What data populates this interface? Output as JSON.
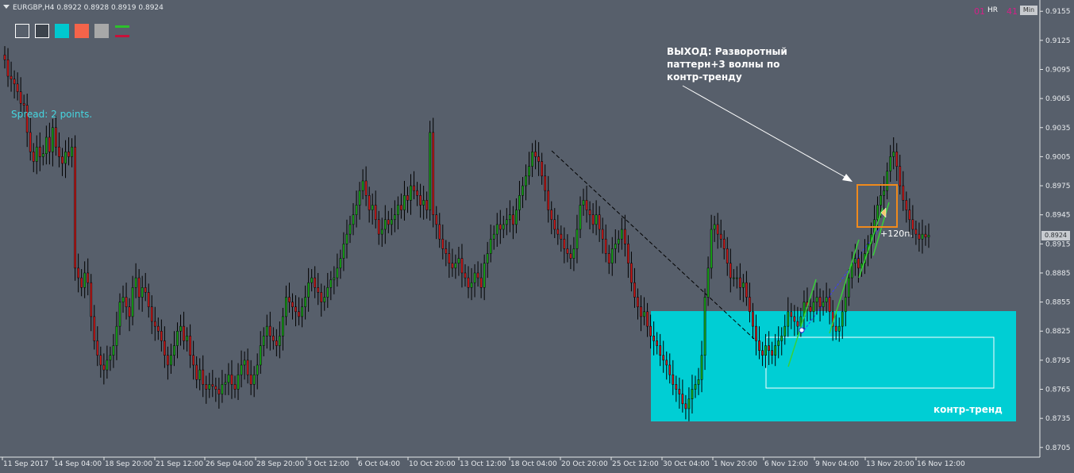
{
  "chart_header": "EURGBP,H4  0.8922 0.8928 0.8919 0.8924",
  "spread": "Spread: 2 points.",
  "annotation": {
    "line1": "ВЫХОД: Разворотный",
    "line2": "паттерн+3 волны по",
    "line3": "контр-тренду"
  },
  "profit_label": "+120п.",
  "zone_label": "контр-тренд",
  "top_right": {
    "hr": "HR",
    "left_digits": "01",
    "right_digits": "41",
    "min_button": "Min"
  },
  "current_price": "0.8924",
  "toolbar_swatches": [
    {
      "name": "swatch-white-frame",
      "color": "#575f6b",
      "border": "#ffffff"
    },
    {
      "name": "swatch-dark-frame",
      "color": "#3c434c",
      "border": "#ffffff"
    },
    {
      "name": "swatch-cyan",
      "color": "#00c8cf",
      "border": "#00c8cf"
    },
    {
      "name": "swatch-coral",
      "color": "#f4644a",
      "border": "#f4644a"
    },
    {
      "name": "swatch-gray",
      "color": "#a8a8a8",
      "border": "#a8a8a8"
    }
  ],
  "colors": {
    "background": "#575f6b",
    "bull_candle": "#16a816",
    "bear_candle": "#d01818",
    "wick": "#000000",
    "zone": "#00ced4",
    "target_box": "#f08a1c",
    "wave_lines": "#38d038",
    "trend_line": "#000000",
    "blue_line": "#3b3cff"
  },
  "chart_data": {
    "type": "candlestick",
    "symbol": "EURGBP",
    "timeframe": "H4",
    "ohlc_last": {
      "open": 0.8922,
      "high": 0.8928,
      "low": 0.8919,
      "close": 0.8924
    },
    "ylim": [
      0.8695,
      0.9165
    ],
    "y_ticks": [
      "0.9155",
      "0.9125",
      "0.9095",
      "0.9065",
      "0.9035",
      "0.9005",
      "0.8975",
      "0.8945",
      "0.8915",
      "0.8885",
      "0.8855",
      "0.8825",
      "0.8795",
      "0.8765",
      "0.8735",
      "0.8705"
    ],
    "x_ticks": [
      "11 Sep 2017",
      "14 Sep 04:00",
      "18 Sep 20:00",
      "21 Sep 12:00",
      "26 Sep 04:00",
      "28 Sep 20:00",
      "3 Oct 12:00",
      "6 Oct 04:00",
      "10 Oct 20:00",
      "13 Oct 12:00",
      "18 Oct 04:00",
      "20 Oct 20:00",
      "25 Oct 12:00",
      "30 Oct 04:00",
      "1 Nov 20:00",
      "6 Nov 12:00",
      "9 Nov 04:00",
      "13 Nov 20:00",
      "16 Nov 12:00"
    ],
    "price_path": [
      0.9105,
      0.9088,
      0.9085,
      0.908,
      0.9072,
      0.906,
      0.9058,
      0.903,
      0.901,
      0.9,
      0.9015,
      0.9005,
      0.9008,
      0.9025,
      0.901,
      0.9035,
      0.9015,
      0.9005,
      0.8998,
      0.901,
      0.9005,
      0.9015,
      0.889,
      0.888,
      0.887,
      0.8885,
      0.8875,
      0.884,
      0.8815,
      0.88,
      0.879,
      0.8785,
      0.8795,
      0.88,
      0.881,
      0.883,
      0.8855,
      0.886,
      0.885,
      0.884,
      0.887,
      0.888,
      0.886,
      0.887,
      0.8865,
      0.885,
      0.8835,
      0.883,
      0.8825,
      0.8815,
      0.88,
      0.879,
      0.88,
      0.881,
      0.8825,
      0.883,
      0.8815,
      0.882,
      0.88,
      0.879,
      0.8775,
      0.8785,
      0.877,
      0.8765,
      0.877,
      0.8768,
      0.8765,
      0.876,
      0.877,
      0.8772,
      0.878,
      0.877,
      0.8765,
      0.878,
      0.879,
      0.8795,
      0.878,
      0.877,
      0.878,
      0.879,
      0.881,
      0.882,
      0.883,
      0.882,
      0.8815,
      0.881,
      0.882,
      0.884,
      0.886,
      0.8855,
      0.885,
      0.8845,
      0.884,
      0.885,
      0.886,
      0.8875,
      0.888,
      0.887,
      0.8865,
      0.8855,
      0.886,
      0.887,
      0.8878,
      0.888,
      0.889,
      0.89,
      0.8915,
      0.8925,
      0.8935,
      0.8945,
      0.8955,
      0.897,
      0.898,
      0.8965,
      0.895,
      0.8955,
      0.894,
      0.8925,
      0.893,
      0.894,
      0.8935,
      0.894,
      0.8945,
      0.8955,
      0.895,
      0.8965,
      0.896,
      0.8975,
      0.897,
      0.8965,
      0.8955,
      0.896,
      0.895,
      0.903,
      0.8945,
      0.8935,
      0.892,
      0.891,
      0.8905,
      0.8895,
      0.889,
      0.8895,
      0.89,
      0.8885,
      0.888,
      0.887,
      0.8875,
      0.8885,
      0.888,
      0.887,
      0.8895,
      0.8905,
      0.892,
      0.8925,
      0.8935,
      0.893,
      0.8935,
      0.894,
      0.8945,
      0.8935,
      0.895,
      0.8965,
      0.8975,
      0.8985,
      0.8995,
      0.901,
      0.9005,
      0.9,
      0.8985,
      0.897,
      0.895,
      0.894,
      0.893,
      0.8925,
      0.892,
      0.891,
      0.8905,
      0.89,
      0.891,
      0.893,
      0.8955,
      0.896,
      0.895,
      0.8945,
      0.8935,
      0.8945,
      0.893,
      0.892,
      0.8905,
      0.8895,
      0.891,
      0.8915,
      0.892,
      0.893,
      0.8915,
      0.8895,
      0.8875,
      0.886,
      0.885,
      0.884,
      0.8845,
      0.883,
      0.882,
      0.8815,
      0.881,
      0.88,
      0.8795,
      0.879,
      0.878,
      0.877,
      0.8765,
      0.876,
      0.875,
      0.8745,
      0.8755,
      0.8765,
      0.877,
      0.8775,
      0.88,
      0.886,
      0.889,
      0.893,
      0.8935,
      0.8925,
      0.892,
      0.891,
      0.8895,
      0.888,
      0.888,
      0.888,
      0.887,
      0.8875,
      0.886,
      0.8845,
      0.883,
      0.8815,
      0.8805,
      0.88,
      0.881,
      0.8805,
      0.88,
      0.881,
      0.8815,
      0.882,
      0.883,
      0.8845,
      0.884,
      0.8835,
      0.883,
      0.884,
      0.8855,
      0.885,
      0.8845,
      0.8855,
      0.886,
      0.885,
      0.8855,
      0.886,
      0.8845,
      0.883,
      0.8825,
      0.883,
      0.8845,
      0.886,
      0.888,
      0.8895,
      0.89,
      0.889,
      0.8895,
      0.8905,
      0.8915,
      0.8925,
      0.894,
      0.8955,
      0.8965,
      0.897,
      0.899,
      0.9005,
      0.901,
      0.8995,
      0.8975,
      0.896,
      0.895,
      0.894,
      0.893,
      0.8925,
      0.892,
      0.8925,
      0.8922,
      0.8924
    ]
  }
}
